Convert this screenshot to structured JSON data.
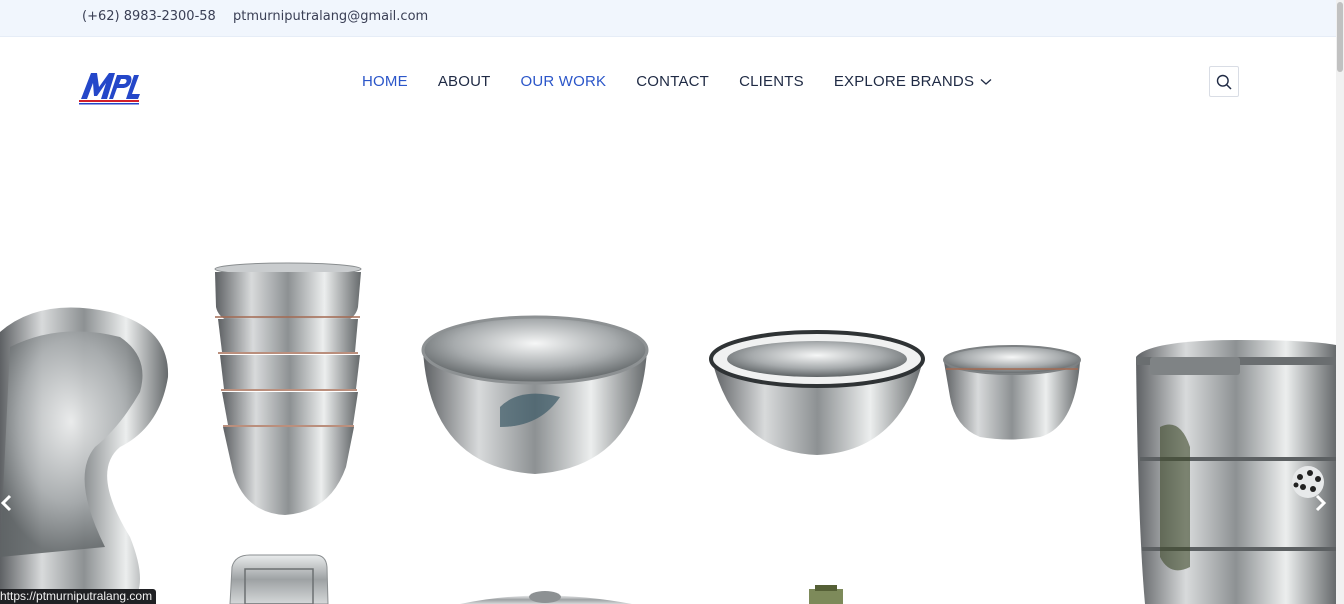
{
  "topbar": {
    "phone": "(+62) 8983-2300-58",
    "email": "ptmurniputralang@gmail.com"
  },
  "logo": {
    "text": "MPL"
  },
  "nav": {
    "home": "HOME",
    "about": "ABOUT",
    "our_work": "OUR WORK",
    "contact": "CONTACT",
    "clients": "CLIENTS",
    "explore_brands": "EXPLORE BRANDS"
  },
  "colors": {
    "accent": "#2b56c9",
    "nav_text": "#1f2a44",
    "topbar_bg": "#f1f6fd"
  },
  "icons": {
    "search": "search-icon",
    "dropdown": "chevron-down-icon",
    "prev": "chevron-left-icon",
    "next": "chevron-right-icon"
  },
  "hero": {
    "slides": [
      "kidney-dish",
      "stacked-bowls",
      "mixing-bowl",
      "wide-bowl",
      "small-bowl",
      "steamer-drum"
    ]
  },
  "status_bar": {
    "url": "https://ptmurniputralang.com"
  }
}
